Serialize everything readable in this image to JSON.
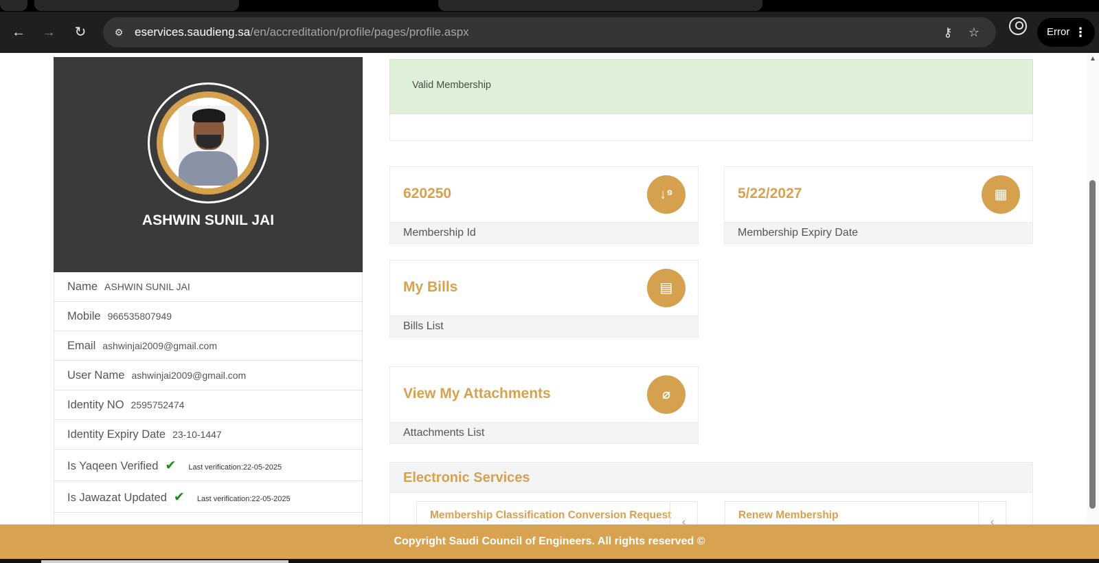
{
  "browser": {
    "url_host": "eservices.saudieng.sa",
    "url_path": "/en/accreditation/profile/pages/profile.aspx",
    "error_label": "Error",
    "icons": {
      "back": "arrow-left-icon",
      "forward": "arrow-right-icon",
      "reload": "reload-icon",
      "site_info": "site-info-icon",
      "password": "key-icon",
      "bookmark": "star-icon",
      "profile": "profile-icon",
      "menu": "more-vertical-icon"
    }
  },
  "profile": {
    "name": "ASHWIN SUNIL JAI",
    "fields": [
      {
        "label": "Name",
        "value": "ASHWIN SUNIL JAI"
      },
      {
        "label": "Mobile",
        "value": "966535807949"
      },
      {
        "label": "Email",
        "value": "ashwinjai2009@gmail.com"
      },
      {
        "label": "User Name",
        "value": "ashwinjai2009@gmail.com"
      },
      {
        "label": "Identity NO",
        "value": "2595752474"
      },
      {
        "label": "Identity Expiry Date",
        "value": "23-10-1447"
      }
    ],
    "verifications": [
      {
        "label": "Is Yaqeen Verified",
        "last_label": "Last verification:",
        "date": "22-05-2025"
      },
      {
        "label": "Is Jawazat Updated",
        "last_label": "Last verification:",
        "date": "22-05-2025"
      }
    ]
  },
  "membership": {
    "status": "Valid Membership",
    "id_value": "620250",
    "id_label": "Membership Id",
    "expiry_value": "5/22/2027",
    "expiry_label": "Membership Expiry Date"
  },
  "bills": {
    "title": "My Bills",
    "subtitle": "Bills List"
  },
  "attachments": {
    "title": "View My Attachments",
    "subtitle": "Attachments List"
  },
  "eservices": {
    "title": "Electronic Services",
    "items": [
      {
        "label": "Membership Classification Conversion Request"
      },
      {
        "label": "Renew Membership"
      }
    ]
  },
  "footer": {
    "copyright": "Copyright Saudi Council of Engineers. All rights reserved ©"
  },
  "colors": {
    "accent": "#d6a14f",
    "success_bg": "#dff0d8",
    "dark_card": "#3a3a3a"
  }
}
